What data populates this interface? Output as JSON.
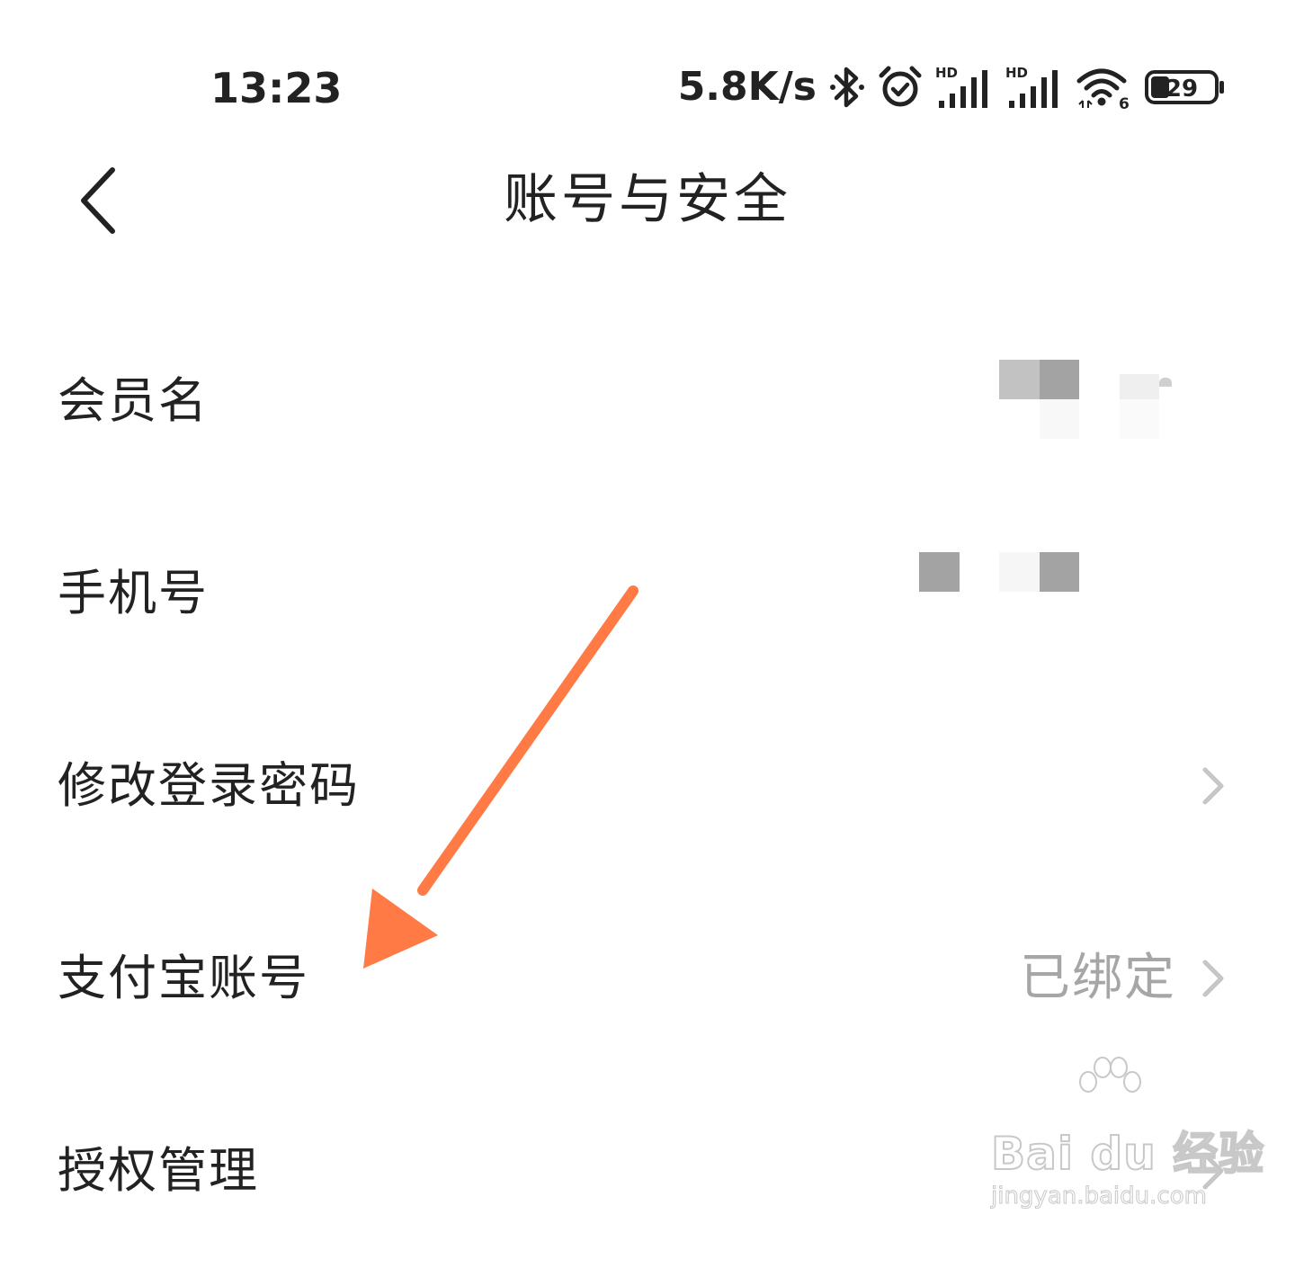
{
  "status_bar": {
    "time": "13:23",
    "net_speed": "5.8K/s",
    "battery_level": "29",
    "icons": [
      "bluetooth-icon",
      "alarm-icon",
      "signal-hd-icon",
      "signal-hd-icon",
      "wifi-6-icon",
      "battery-icon"
    ],
    "signal_badge": "HD",
    "wifi_badge": "6"
  },
  "header": {
    "back_icon": "chevron-left-icon",
    "title": "账号与安全"
  },
  "settings": {
    "items": [
      {
        "label": "会员名",
        "value": "",
        "has_chevron": false
      },
      {
        "label": "手机号",
        "value": "",
        "has_chevron": false
      },
      {
        "label": "修改登录密码",
        "value": "",
        "has_chevron": true
      },
      {
        "label": "支付宝账号",
        "value": "已绑定",
        "has_chevron": true
      },
      {
        "label": "授权管理",
        "value": "",
        "has_chevron": true
      }
    ]
  },
  "annotation": {
    "arrow_color": "#FF7A45"
  },
  "watermark": {
    "line1": "Bai du 经验",
    "line2": "jingyan.baidu.com"
  }
}
